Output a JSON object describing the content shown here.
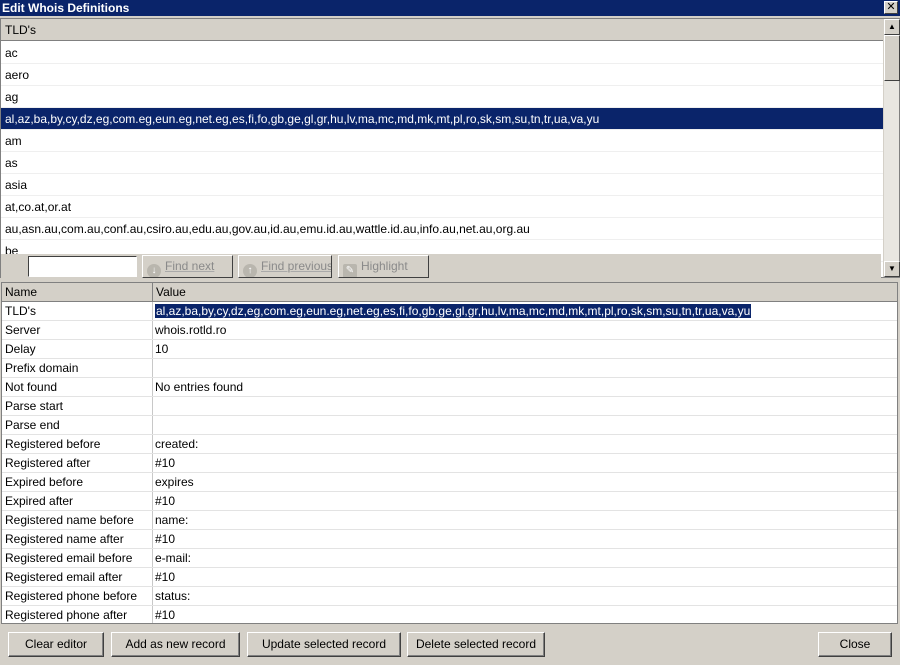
{
  "window": {
    "title": "Edit Whois Definitions",
    "close_glyph": "✕"
  },
  "tld_list": {
    "header": "TLD's",
    "items": [
      "ac",
      "aero",
      "ag",
      "al,az,ba,by,cy,dz,eg,com.eg,eun.eg,net.eg,es,fi,fo,gb,ge,gl,gr,hu,lv,ma,mc,md,mk,mt,pl,ro,sk,sm,su,tn,tr,ua,va,yu",
      "am",
      "as",
      "asia",
      "at,co.at,or.at",
      "au,asn.au,com.au,conf.au,csiro.au,edu.au,gov.au,id.au,emu.id.au,wattle.id.au,info.au,net.au,org.au",
      "be"
    ],
    "selected_index": 3
  },
  "find_bar": {
    "input_value": "",
    "find_next_label": "Find next",
    "find_previous_label": "Find previous",
    "highlight_label": "Highlight"
  },
  "grid": {
    "col_name": "Name",
    "col_value": "Value",
    "rows": [
      {
        "name": "TLD's",
        "value": "al,az,ba,by,cy,dz,eg,com.eg,eun.eg,net.eg,es,fi,fo,gb,ge,gl,gr,hu,lv,ma,mc,md,mk,mt,pl,ro,sk,sm,su,tn,tr,ua,va,yu"
      },
      {
        "name": "Server",
        "value": "whois.rotld.ro"
      },
      {
        "name": "Delay",
        "value": "10"
      },
      {
        "name": "Prefix domain",
        "value": ""
      },
      {
        "name": "Not found",
        "value": "No entries found"
      },
      {
        "name": "Parse start",
        "value": ""
      },
      {
        "name": "Parse end",
        "value": ""
      },
      {
        "name": "Registered before",
        "value": "created:"
      },
      {
        "name": "Registered after",
        "value": "#10"
      },
      {
        "name": "Expired before",
        "value": "expires"
      },
      {
        "name": "Expired after",
        "value": "#10"
      },
      {
        "name": "Registered name before",
        "value": "name:"
      },
      {
        "name": "Registered name after",
        "value": "#10"
      },
      {
        "name": "Registered email before",
        "value": "e-mail:"
      },
      {
        "name": "Registered email after",
        "value": "#10"
      },
      {
        "name": "Registered phone before",
        "value": "status:"
      },
      {
        "name": "Registered phone after",
        "value": "#10"
      }
    ]
  },
  "buttons": {
    "clear_editor": "Clear editor",
    "add_new": "Add as new record",
    "update_selected": "Update selected record",
    "delete_selected": "Delete selected record",
    "close": "Close"
  },
  "colors": {
    "selection": "#0a246a",
    "face": "#d4d0c8"
  }
}
